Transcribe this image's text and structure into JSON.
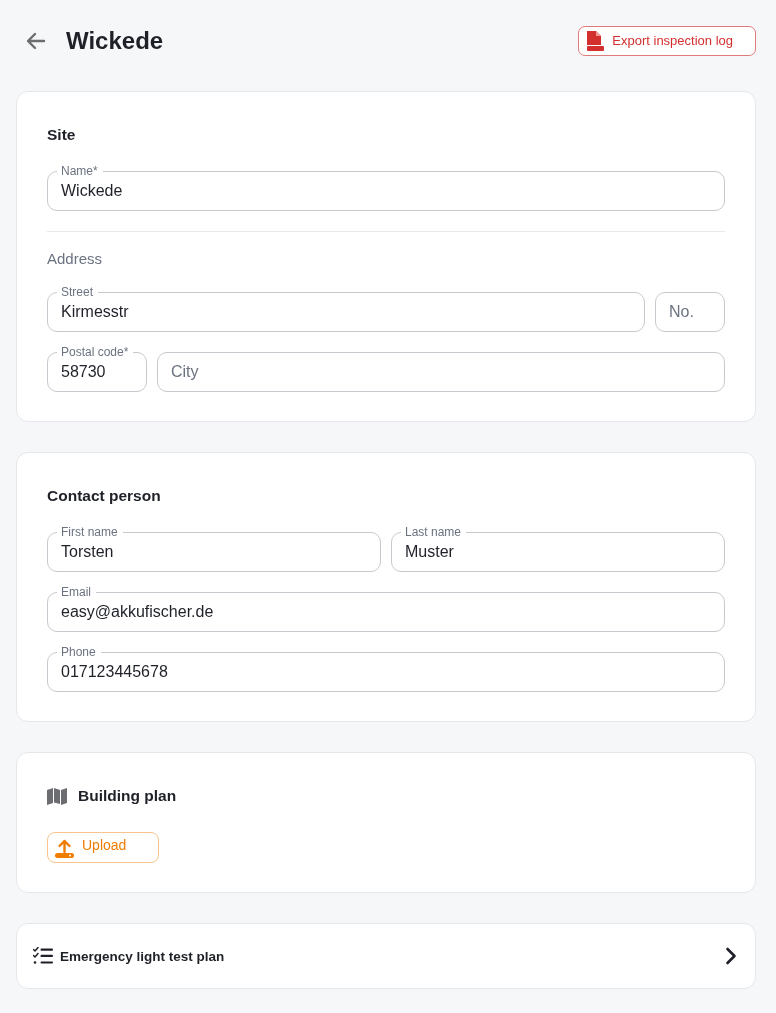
{
  "header": {
    "title": "Wickede",
    "export_button": {
      "label": "Export inspection log"
    }
  },
  "site": {
    "title": "Site",
    "name": {
      "label": "Name*",
      "value": "Wickede"
    },
    "address": {
      "heading": "Address",
      "street": {
        "label": "Street",
        "value": "Kirmesstr"
      },
      "number": {
        "placeholder": "No."
      },
      "postal_code": {
        "label": "Postal code*",
        "value": "58730"
      },
      "city": {
        "placeholder": "City"
      }
    }
  },
  "contact_person": {
    "title": "Contact person",
    "first_name": {
      "label": "First name",
      "value": "Torsten"
    },
    "last_name": {
      "label": "Last name",
      "value": "Muster"
    },
    "email": {
      "label": "Email",
      "value": "easy@akkufischer.de"
    },
    "phone": {
      "label": "Phone",
      "value": "017123445678"
    }
  },
  "building_plan": {
    "title": "Building plan",
    "upload_button": {
      "label": "Upload"
    }
  },
  "test_plan_link": {
    "label": "Emergency light test plan"
  }
}
